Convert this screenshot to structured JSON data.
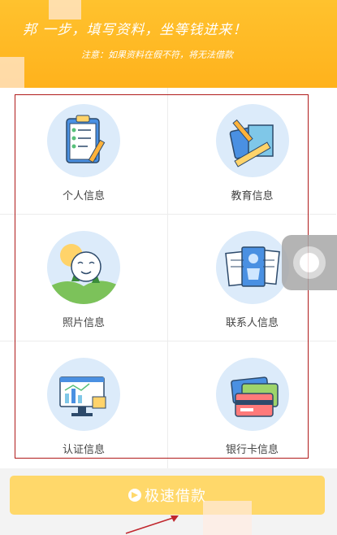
{
  "banner": {
    "title": "邦  一步，填写资料，坐等钱进来！",
    "note": "注意：如果资料在假不符，将无法借款"
  },
  "items": [
    {
      "label": "个人信息",
      "icon": "clipboard-checklist-icon"
    },
    {
      "label": "教育信息",
      "icon": "books-ruler-icon"
    },
    {
      "label": "照片信息",
      "icon": "smiling-face-sun-icon"
    },
    {
      "label": "联系人信息",
      "icon": "contact-cards-icon"
    },
    {
      "label": "认证信息",
      "icon": "monitor-chart-icon"
    },
    {
      "label": "银行卡信息",
      "icon": "bank-cards-icon"
    }
  ],
  "loan_button": {
    "label": "极速借款",
    "icon": "arrow-circle-icon"
  },
  "colors": {
    "banner": "#ffb21c",
    "button": "#ffd86a",
    "circle": "#dcebfa",
    "highlight": "#b01b1b"
  }
}
